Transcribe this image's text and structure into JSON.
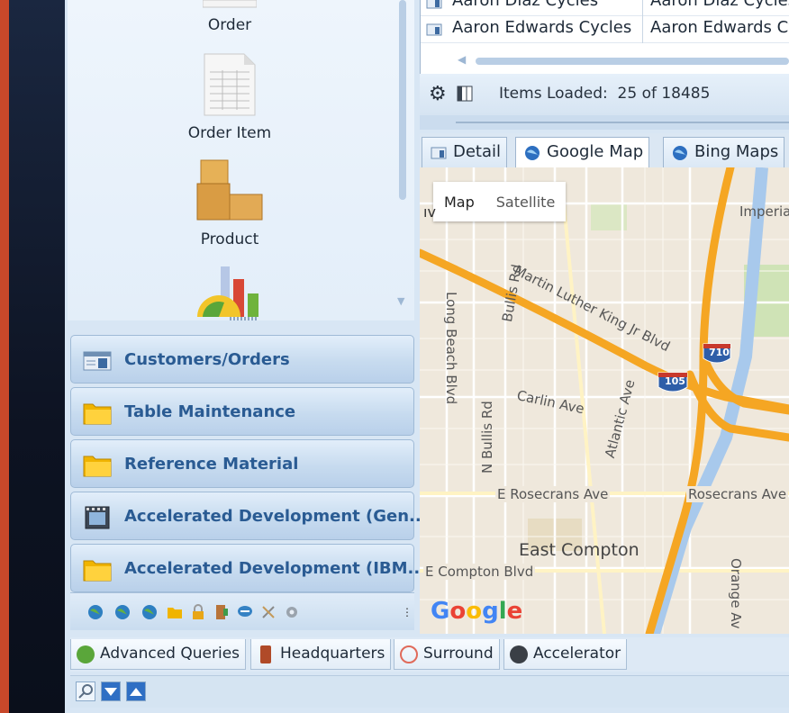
{
  "nav": {
    "items": [
      {
        "label": "Order",
        "icon": "order-icon"
      },
      {
        "label": "Order Item",
        "icon": "order-item-icon"
      },
      {
        "label": "Product",
        "icon": "product-icon"
      }
    ],
    "groups": [
      {
        "label": "Customers/Orders",
        "icon": "customers-orders-icon"
      },
      {
        "label": "Table Maintenance",
        "icon": "folder-icon"
      },
      {
        "label": "Reference Material",
        "icon": "folder-icon"
      },
      {
        "label": "Accelerated Development (Gen...",
        "icon": "film-icon"
      },
      {
        "label": "Accelerated Development (IBM...",
        "icon": "folder-icon"
      }
    ]
  },
  "bottom_tabs": [
    {
      "label": "Advanced Queries",
      "icon": "question-icon"
    },
    {
      "label": "Headquarters",
      "icon": "headquarters-icon"
    },
    {
      "label": "Surround",
      "icon": "surround-icon"
    },
    {
      "label": "Accelerator",
      "icon": "accelerator-icon"
    }
  ],
  "grid": {
    "rows": [
      {
        "col1": "Aaron Diaz Cycles",
        "col2": "Aaron Diaz Cycles"
      },
      {
        "col1": "Aaron Edwards Cycles",
        "col2": "Aaron Edwards Cy"
      }
    ]
  },
  "items_loaded": {
    "label": "Items Loaded:",
    "value": "25 of 18485"
  },
  "map_tabs": [
    {
      "label": "Detail",
      "icon": "detail-icon"
    },
    {
      "label": "Google Map",
      "icon": "globe-icon"
    },
    {
      "label": "Bing Maps",
      "icon": "globe-icon"
    }
  ],
  "map": {
    "type_buttons": {
      "map": "Map",
      "satellite": "Satellite"
    },
    "labels": {
      "mlk": "Martin Luther King Jr Blvd",
      "long_beach": "Long Beach Blvd",
      "bullis": "Bullis Rd",
      "n_bullis": "N Bullis Rd",
      "carlin": "Carlin Ave",
      "atlantic": "Atlantic Ave",
      "rosecrans_e": "E Rosecrans Ave",
      "rosecrans": "Rosecrans Ave",
      "east_compton": "East Compton",
      "e_compton_blvd": "E Compton Blvd",
      "orange": "Orange Av",
      "imperial": "Imperia",
      "i710": "710",
      "i105": "105",
      "edge_letters": "ıv"
    },
    "google": [
      "G",
      "o",
      "o",
      "g",
      "l",
      "e"
    ]
  },
  "colors": {
    "brand_orange": "#c8482a",
    "group_text": "#2a5b93",
    "freeway": "#f5a623"
  }
}
